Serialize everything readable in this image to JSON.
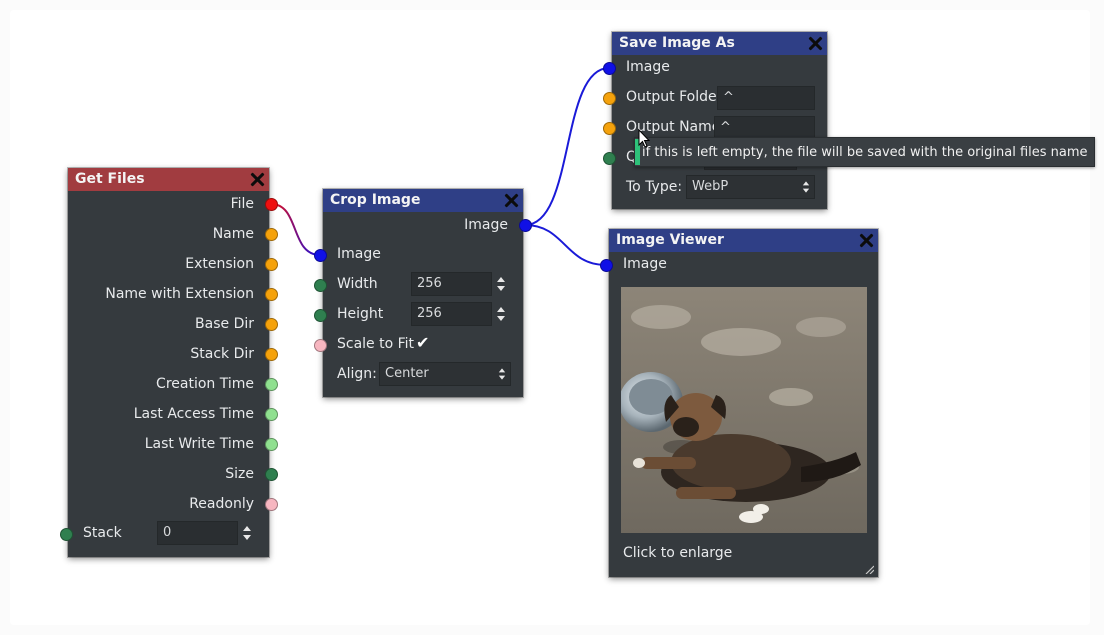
{
  "colors": {
    "node_bg": "#353a3e",
    "header_red": "#a13c40",
    "header_blue": "#2f3f86",
    "port_image": "#1010e6",
    "port_string": "#f5a20c",
    "port_time": "#8fe08f",
    "port_number": "#2f7f4f",
    "port_bool": "#f7b6c0",
    "port_file": "#ee1010"
  },
  "get_files": {
    "title": "Get Files",
    "outputs": [
      {
        "label": "File",
        "port": "file"
      },
      {
        "label": "Name",
        "port": "string"
      },
      {
        "label": "Extension",
        "port": "string"
      },
      {
        "label": "Name with Extension",
        "port": "string"
      },
      {
        "label": "Base Dir",
        "port": "string"
      },
      {
        "label": "Stack Dir",
        "port": "string"
      },
      {
        "label": "Creation Time",
        "port": "time"
      },
      {
        "label": "Last Access Time",
        "port": "time"
      },
      {
        "label": "Last Write Time",
        "port": "time"
      },
      {
        "label": "Size",
        "port": "number"
      },
      {
        "label": "Readonly",
        "port": "bool"
      }
    ],
    "stack_label": "Stack",
    "stack_value": "0"
  },
  "crop_image": {
    "title": "Crop Image",
    "output_label": "Image",
    "input_label": "Image",
    "width_label": "Width",
    "width_value": "256",
    "height_label": "Height",
    "height_value": "256",
    "scale_label": "Scale to Fit",
    "scale_checked": "✔",
    "align_label": "Align:",
    "align_value": "Center"
  },
  "save_image": {
    "title": "Save Image As",
    "image_label": "Image",
    "folder_label": "Output Folder",
    "folder_value": "^",
    "name_label": "Output Name",
    "name_value": "^",
    "quality_label_partial": "Q",
    "type_label": "To Type:",
    "type_value": "WebP"
  },
  "image_viewer": {
    "title": "Image Viewer",
    "image_label": "Image",
    "footer": "Click to enlarge"
  },
  "tooltip": {
    "text": "if this is left empty, the file will be saved with the original files name"
  }
}
